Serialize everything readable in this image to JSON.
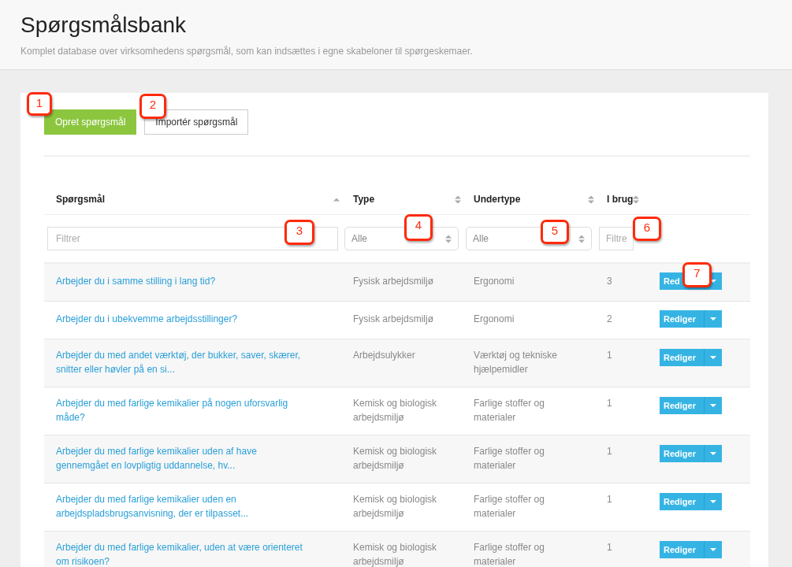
{
  "header": {
    "title": "Spørgsmålsbank",
    "subtitle": "Komplet database over virksomhedens spørgsmål, som kan indsættes i egne skabeloner til spørgeskemaer."
  },
  "actions": [
    {
      "label": "Opret spørgsmål",
      "kind": "primary"
    },
    {
      "label": "Importér spørgsmål",
      "kind": "secondary"
    }
  ],
  "table": {
    "columns": [
      {
        "label": "Spørgsmål",
        "sorted": true
      },
      {
        "label": "Type",
        "sorted": false
      },
      {
        "label": "Undertype",
        "sorted": false
      },
      {
        "label": "I brug",
        "sorted": false
      }
    ],
    "filters": [
      {
        "kind": "text",
        "placeholder": "Filtrer"
      },
      {
        "kind": "select",
        "value": "Alle"
      },
      {
        "kind": "select",
        "value": "Alle"
      },
      {
        "kind": "text",
        "placeholder": "Filtre"
      }
    ],
    "rows": [
      {
        "question": "Arbejder du i samme stilling i lang tid?",
        "type": "Fysisk arbejdsmiljø",
        "subtype": "Ergonomi",
        "in_use": "3",
        "button": "Red"
      },
      {
        "question": "Arbejder du i ubekvemme arbejdsstillinger?",
        "type": "Fysisk arbejdsmiljø",
        "subtype": "Ergonomi",
        "in_use": "2",
        "button": "Rediger"
      },
      {
        "question": "Arbejder du med andet værktøj, der bukker, saver, skærer, snitter eller høvler på en si...",
        "type": "Arbejdsulykker",
        "subtype": "Værktøj og tekniske hjælpemidler",
        "in_use": "1",
        "button": "Rediger"
      },
      {
        "question": "Arbejder du med farlige kemikalier på nogen uforsvarlig måde?",
        "type": "Kemisk og biologisk arbejdsmiljø",
        "subtype": "Farlige stoffer og materialer",
        "in_use": "1",
        "button": "Rediger"
      },
      {
        "question": "Arbejder du med farlige kemikalier uden af have gennemgået en lovpligtig uddannelse, hv...",
        "type": "Kemisk og biologisk arbejdsmiljø",
        "subtype": "Farlige stoffer og materialer",
        "in_use": "1",
        "button": "Rediger"
      },
      {
        "question": "Arbejder du med farlige kemikalier uden en arbejdspladsbrugsanvisning, der er tilpasset...",
        "type": "Kemisk og biologisk arbejdsmiljø",
        "subtype": "Farlige stoffer og materialer",
        "in_use": "1",
        "button": "Rediger"
      },
      {
        "question": "Arbejder du med farlige kemikalier, uden at være orienteret om risikoen?",
        "type": "Kemisk og biologisk arbejdsmiljø",
        "subtype": "Farlige stoffer og materialer",
        "in_use": "1",
        "button": "Rediger"
      }
    ]
  },
  "callouts": [
    {
      "label": "1"
    },
    {
      "label": "2"
    },
    {
      "label": "3"
    },
    {
      "label": "4"
    },
    {
      "label": "5"
    },
    {
      "label": "6"
    },
    {
      "label": "7"
    }
  ]
}
